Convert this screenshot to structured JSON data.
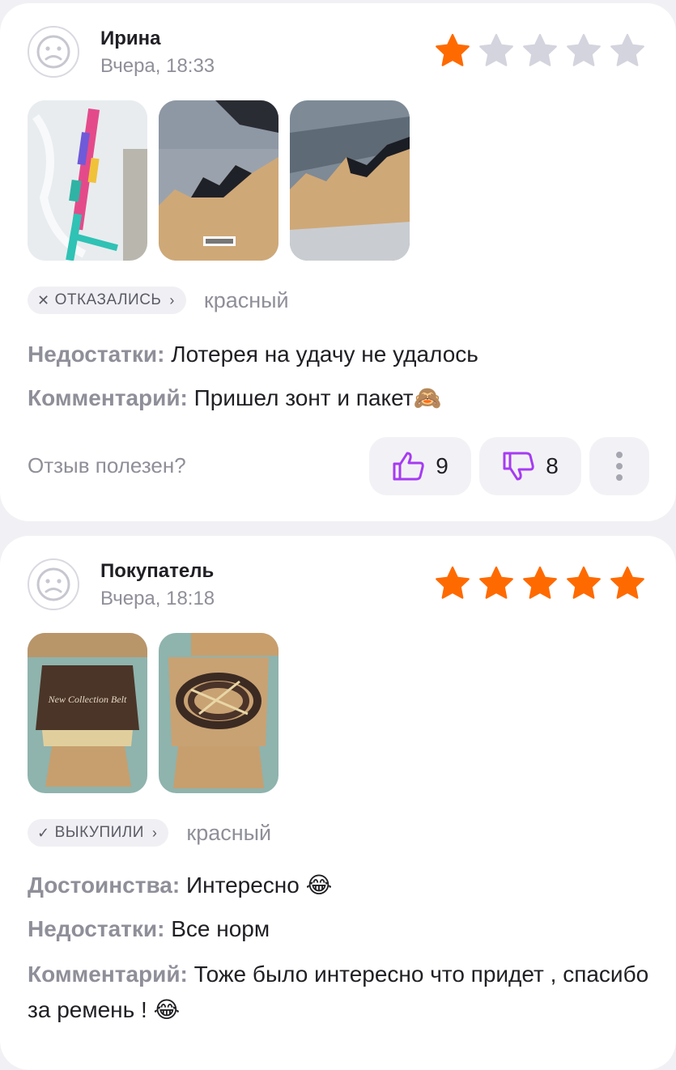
{
  "reviews": [
    {
      "author": "Ирина",
      "date": "Вчера, 18:33",
      "rating": 1,
      "max_rating": 5,
      "photos": [
        "umbrella-package-photo",
        "torn-parcel-box-photo",
        "torn-parcel-box-photo-2"
      ],
      "status": {
        "label": "ОТКАЗАЛИСЬ",
        "mark": "✕",
        "chevron": "›"
      },
      "variant": "красный",
      "fields": [
        {
          "label": "Недостатки:",
          "text": "Лотерея на удачу не удалось"
        },
        {
          "label": "Комментарий:",
          "text": "Пришел зонт и пакет🙈"
        }
      ],
      "helpful_text": "Отзыв полезен?",
      "likes": "9",
      "dislikes": "8"
    },
    {
      "author": "Покупатель",
      "date": "Вчера, 18:18",
      "rating": 5,
      "max_rating": 5,
      "photos": [
        "belt-gift-box-photo",
        "belt-in-box-photo"
      ],
      "box_print": "New Collection Belt",
      "status": {
        "label": "ВЫКУПИЛИ",
        "mark": "✓",
        "chevron": "›"
      },
      "variant": "красный",
      "fields": [
        {
          "label": "Достоинства:",
          "text": "Интересно 😂"
        },
        {
          "label": "Недостатки:",
          "text": "Все норм"
        },
        {
          "label": "Комментарий:",
          "text": "Тоже было интересно что придет , спасибо за ремень ! 😂"
        }
      ]
    }
  ],
  "colors": {
    "star_active": "#ff6a00",
    "star_inactive": "#d4d4de",
    "accent_purple": "#a63bf2",
    "page_background": "#f1f1f5"
  }
}
